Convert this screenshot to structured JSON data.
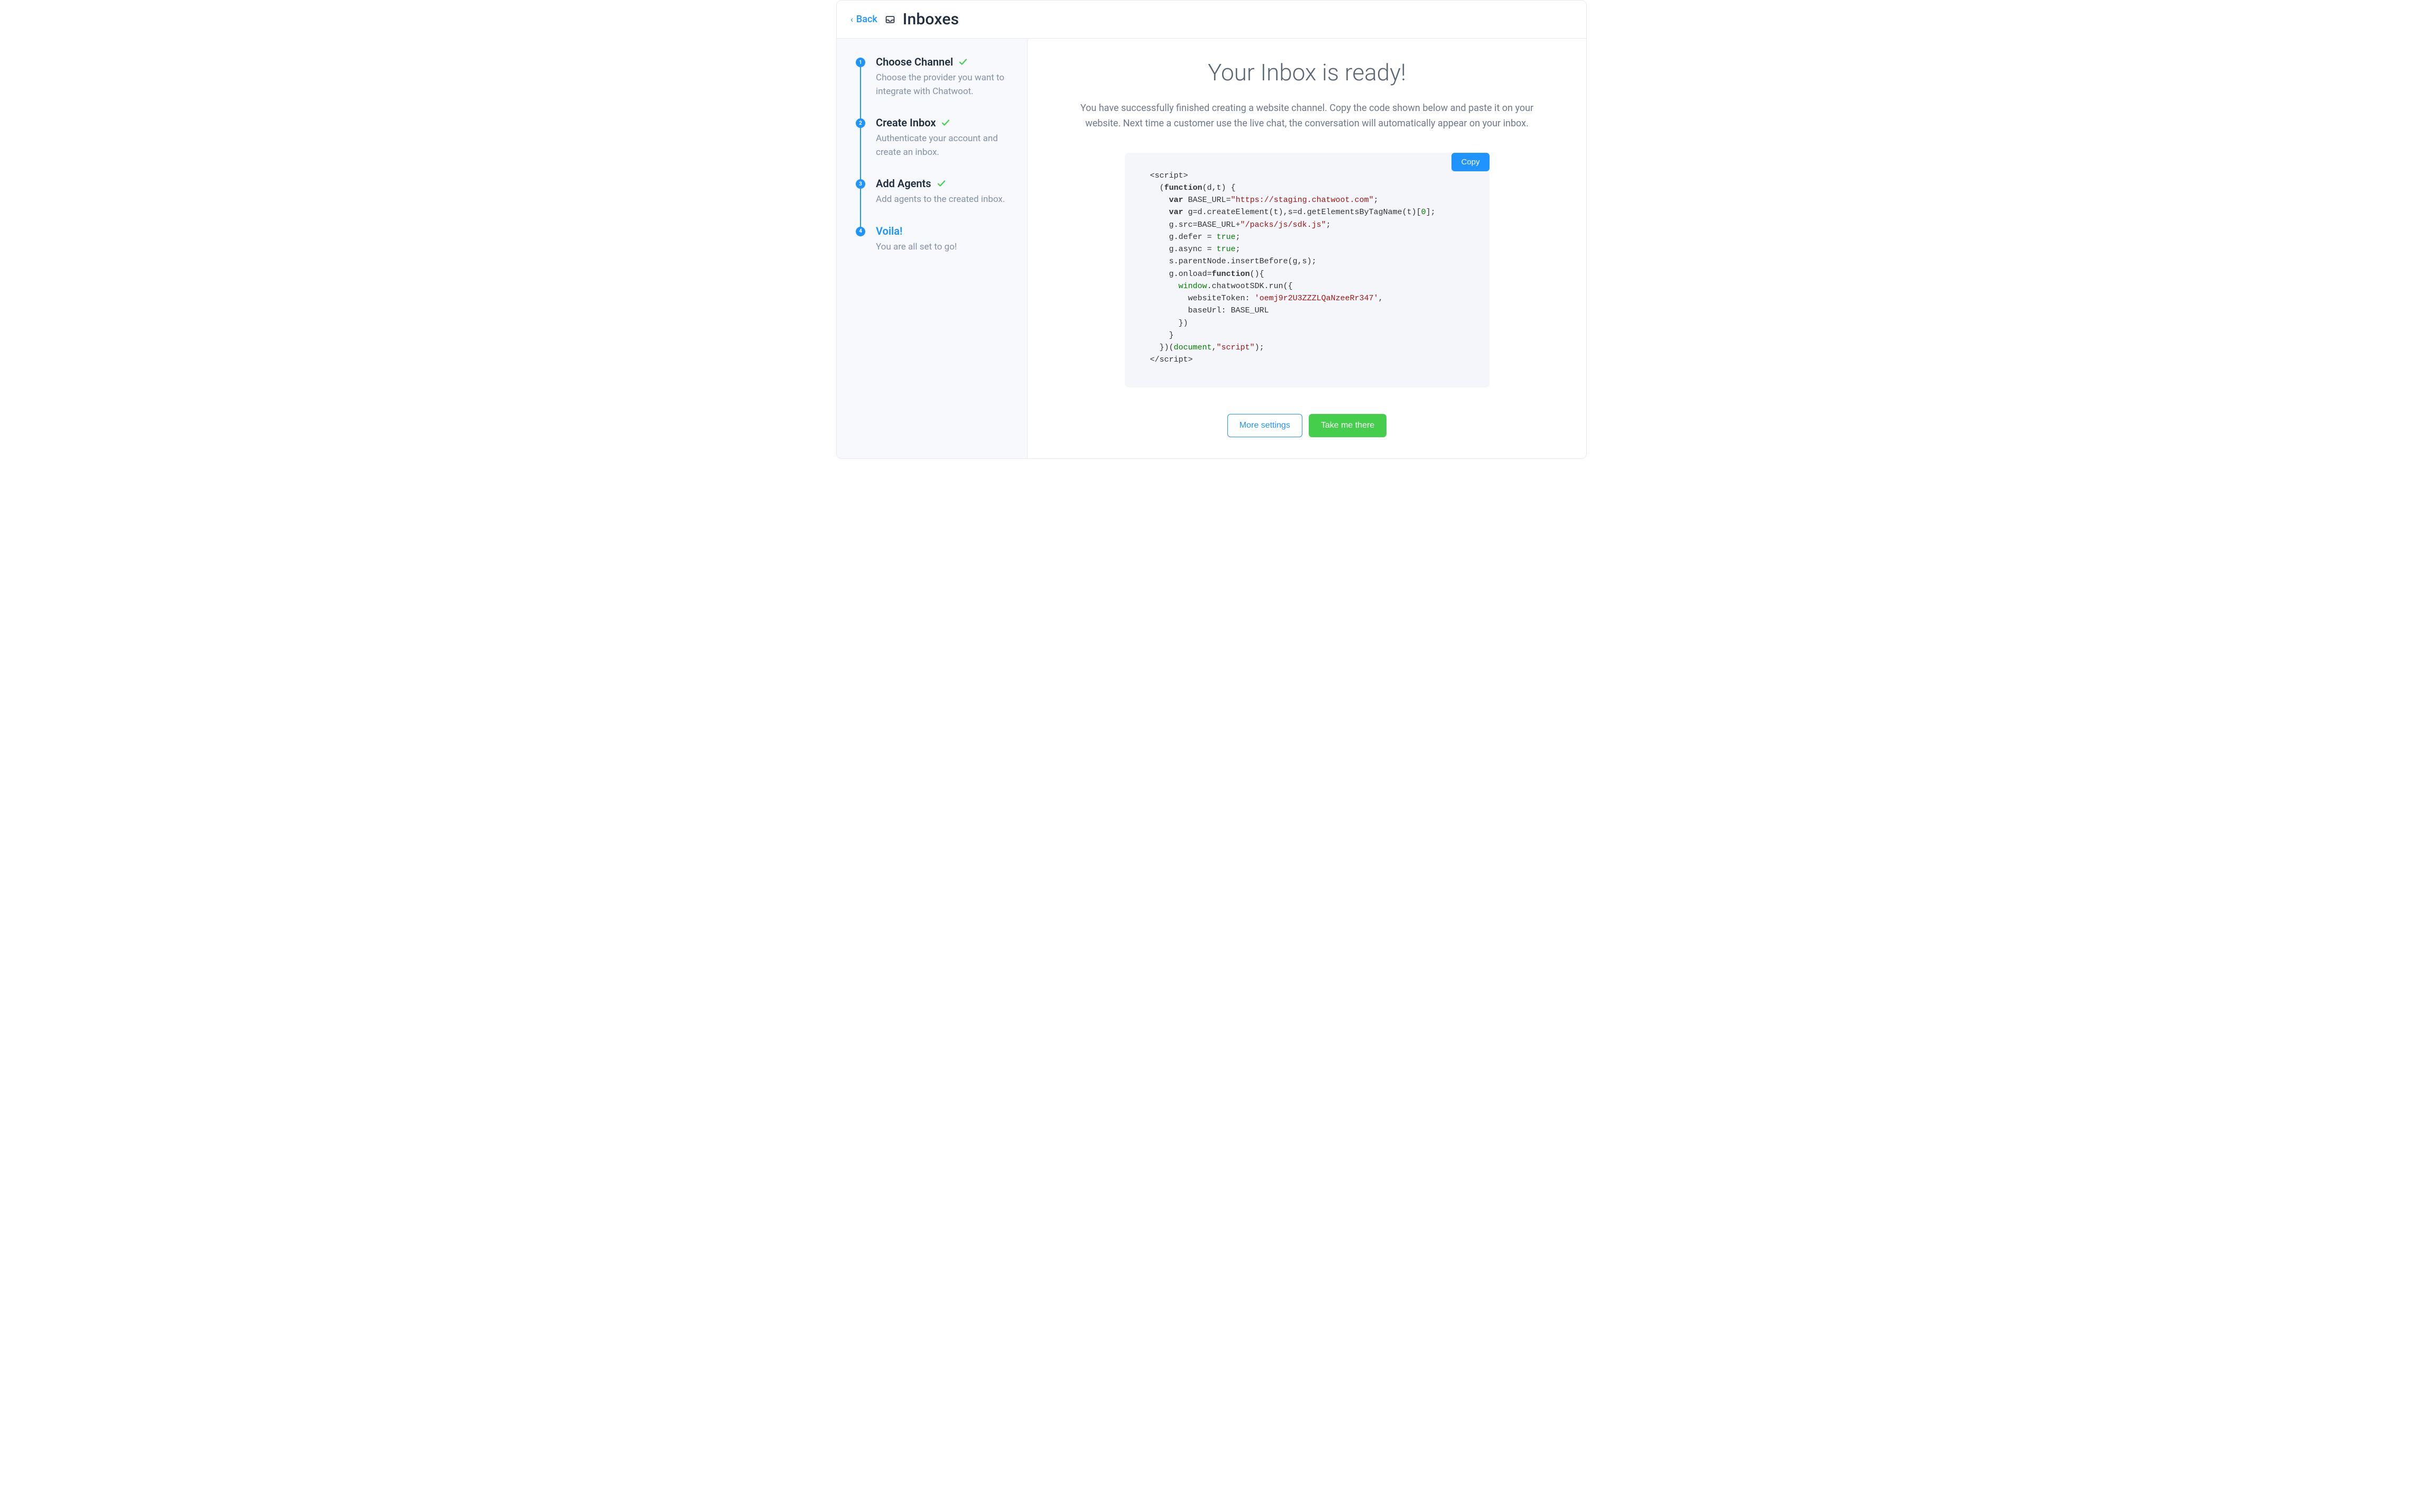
{
  "header": {
    "back_label": "Back",
    "title": "Inboxes"
  },
  "steps": [
    {
      "num": "1",
      "title": "Choose Channel",
      "completed": true,
      "desc": "Choose the provider you want to integrate with Chatwoot."
    },
    {
      "num": "2",
      "title": "Create Inbox",
      "completed": true,
      "desc": "Authenticate your account and create an inbox."
    },
    {
      "num": "3",
      "title": "Add Agents",
      "completed": true,
      "desc": "Add agents to the created inbox."
    },
    {
      "num": "4",
      "title": "Voila!",
      "completed": false,
      "active": true,
      "desc": "You are all set to go!"
    }
  ],
  "main": {
    "heading": "Your Inbox is ready!",
    "description": "You have successfully finished creating a website channel. Copy the code shown below and paste it on your website. Next time a customer use the live chat, the conversation will automatically appear on your inbox.",
    "copy_label": "Copy",
    "code": {
      "base_url": "https://staging.chatwoot.com",
      "sdk_path": "/packs/js/sdk.js",
      "website_token": "oemj9r2U3ZZZLQaNzeeRr347",
      "tokens": {
        "script_open": "<script>",
        "script_close": "</script>",
        "function": "function",
        "var": "var",
        "true": "true",
        "zero": "0",
        "document": "document",
        "script_lit": "\"script\"",
        "window": "window"
      }
    },
    "actions": {
      "more_settings": "More settings",
      "take_me_there": "Take me there"
    }
  }
}
